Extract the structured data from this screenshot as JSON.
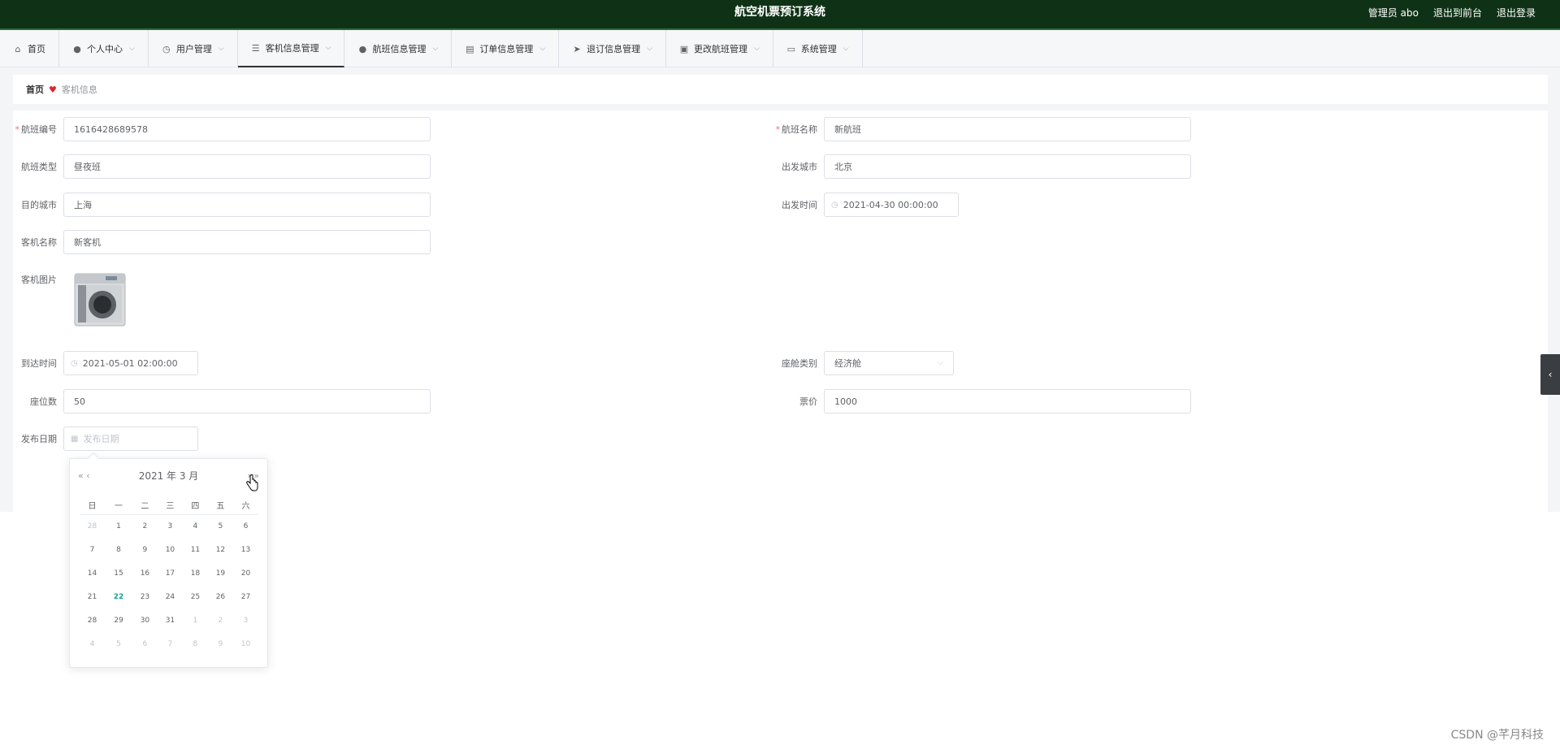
{
  "header": {
    "title": "航空机票预订系统",
    "user": "管理员 abo",
    "goto_front": "退出到前台",
    "logout": "退出登录"
  },
  "menu": [
    {
      "label": "首页",
      "icon": "home-icon",
      "glyph": "⌂",
      "chevron": false
    },
    {
      "label": "个人中心",
      "icon": "user-icon",
      "glyph": "●",
      "chevron": true
    },
    {
      "label": "用户管理",
      "icon": "clock-icon",
      "glyph": "◷",
      "chevron": true
    },
    {
      "label": "客机信息管理",
      "icon": "list-icon",
      "glyph": "☰",
      "chevron": true
    },
    {
      "label": "航班信息管理",
      "icon": "user-icon",
      "glyph": "●",
      "chevron": true
    },
    {
      "label": "订单信息管理",
      "icon": "printer-icon",
      "glyph": "▤",
      "chevron": true
    },
    {
      "label": "退订信息管理",
      "icon": "send-icon",
      "glyph": "➤",
      "chevron": true
    },
    {
      "label": "更改航班管理",
      "icon": "clipboard-icon",
      "glyph": "▣",
      "chevron": true
    },
    {
      "label": "系统管理",
      "icon": "chat-icon",
      "glyph": "▭",
      "chevron": true
    }
  ],
  "breadcrumb": {
    "home": "首页",
    "current": "客机信息"
  },
  "form": {
    "flight_no": {
      "label": "航班编号",
      "value": "1616428689578"
    },
    "flight_name": {
      "label": "航班名称",
      "value": "新航班"
    },
    "flight_type": {
      "label": "航班类型",
      "value": "昼夜班"
    },
    "depart_city": {
      "label": "出发城市",
      "value": "北京"
    },
    "dest_city": {
      "label": "目的城市",
      "value": "上海"
    },
    "depart_time": {
      "label": "出发时间",
      "value": "2021-04-30 00:00:00"
    },
    "plane_name": {
      "label": "客机名称",
      "value": "新客机"
    },
    "plane_image": {
      "label": "客机图片"
    },
    "arrive_time": {
      "label": "到达时间",
      "value": "2021-05-01 02:00:00"
    },
    "cabin_class": {
      "label": "座舱类别",
      "value": "经济舱"
    },
    "seats": {
      "label": "座位数",
      "value": "50"
    },
    "price": {
      "label": "票价",
      "value": "1000"
    },
    "publish_date": {
      "label": "发布日期",
      "placeholder": "发布日期"
    }
  },
  "datepicker": {
    "header": "2021 年  3 月",
    "prev_year": "«",
    "prev_month": "‹",
    "next_month": "›",
    "next_year": "»",
    "weekdays": [
      "日",
      "一",
      "二",
      "三",
      "四",
      "五",
      "六"
    ],
    "weeks": [
      [
        {
          "d": "28",
          "o": true
        },
        {
          "d": "1"
        },
        {
          "d": "2"
        },
        {
          "d": "3"
        },
        {
          "d": "4"
        },
        {
          "d": "5"
        },
        {
          "d": "6"
        }
      ],
      [
        {
          "d": "7"
        },
        {
          "d": "8"
        },
        {
          "d": "9"
        },
        {
          "d": "10"
        },
        {
          "d": "11"
        },
        {
          "d": "12"
        },
        {
          "d": "13"
        }
      ],
      [
        {
          "d": "14"
        },
        {
          "d": "15"
        },
        {
          "d": "16"
        },
        {
          "d": "17"
        },
        {
          "d": "18"
        },
        {
          "d": "19"
        },
        {
          "d": "20"
        }
      ],
      [
        {
          "d": "21"
        },
        {
          "d": "22",
          "today": true
        },
        {
          "d": "23"
        },
        {
          "d": "24"
        },
        {
          "d": "25"
        },
        {
          "d": "26"
        },
        {
          "d": "27"
        }
      ],
      [
        {
          "d": "28"
        },
        {
          "d": "29"
        },
        {
          "d": "30"
        },
        {
          "d": "31"
        },
        {
          "d": "1",
          "o": true
        },
        {
          "d": "2",
          "o": true
        },
        {
          "d": "3",
          "o": true
        }
      ],
      [
        {
          "d": "4",
          "o": true
        },
        {
          "d": "5",
          "o": true
        },
        {
          "d": "6",
          "o": true
        },
        {
          "d": "7",
          "o": true
        },
        {
          "d": "8",
          "o": true
        },
        {
          "d": "9",
          "o": true
        },
        {
          "d": "10",
          "o": true
        }
      ]
    ]
  },
  "side_tab": "‹",
  "watermark": "CSDN @芊月科技",
  "colors": {
    "header_bg": "#0f3217",
    "today": "#1aa094",
    "required": "#f56c6c"
  }
}
